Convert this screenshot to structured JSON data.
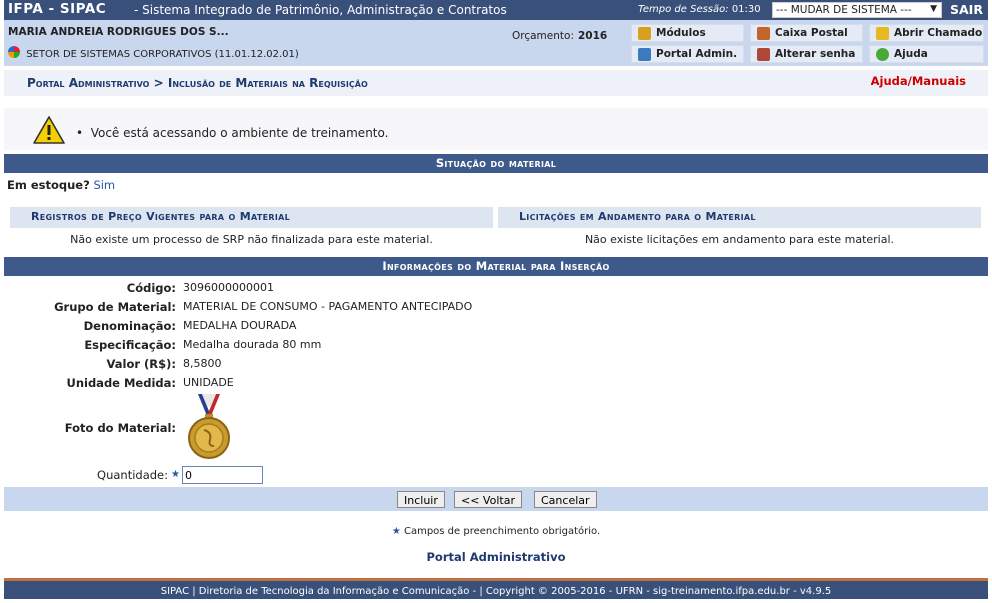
{
  "topbar": {
    "brand": "IFPA - SIPAC",
    "system_name": "- Sistema Integrado de Patrimônio, Administração e Contratos",
    "session_label": "Tempo de Sessão:",
    "session_time": "01:30",
    "system_select": "--- MUDAR DE SISTEMA ---",
    "logout": "SAIR"
  },
  "infobar": {
    "user": "MARIA ANDREIA RODRIGUES DOS S...",
    "department": "SETOR DE SISTEMAS CORPORATIVOS (11.01.12.02.01)",
    "budget_label": "Orçamento:",
    "budget_year": "2016",
    "buttons": {
      "modules": "Módulos",
      "mailbox": "Caixa Postal",
      "ticket": "Abrir Chamado",
      "admin_portal": "Portal Admin.",
      "change_password": "Alterar senha",
      "help": "Ajuda"
    }
  },
  "breadcrumb": {
    "path": "Portal Administrativo > Inclusão de Materiais na Requisição",
    "help_link": "Ajuda/Manuais"
  },
  "warning": {
    "message": "Você está acessando o ambiente de treinamento."
  },
  "material_status": {
    "header": "Situação do material",
    "in_stock_label": "Em estoque?",
    "in_stock_value": "Sim",
    "srp_header": "Registros de Preço Vigentes para o Material",
    "bids_header": "Licitações em Andamento para o Material",
    "srp_message": "Não existe um processo de SRP não finalizada para este material.",
    "bids_message": "Não existe licitações em andamento para este material."
  },
  "material_info": {
    "header": "Informações do Material para Inserção",
    "fields": [
      {
        "label": "Código:",
        "value": "3096000000001"
      },
      {
        "label": "Grupo de Material:",
        "value": "MATERIAL DE CONSUMO - PAGAMENTO ANTECIPADO"
      },
      {
        "label": "Denominação:",
        "value": "MEDALHA DOURADA"
      },
      {
        "label": "Especificação:",
        "value": "Medalha dourada 80 mm"
      },
      {
        "label": "Valor (R$):",
        "value": "8,5800"
      },
      {
        "label": "Unidade Medida:",
        "value": "UNIDADE"
      }
    ],
    "photo_label": "Foto do Material:",
    "quantity_label": "Quantidade:",
    "quantity_value": "0"
  },
  "actions": {
    "include": "Incluir",
    "back": "<< Voltar",
    "cancel": "Cancelar"
  },
  "required_note": "Campos de preenchimento obrigatório.",
  "portal_link": "Portal Administrativo",
  "footer": "SIPAC | Diretoria de Tecnologia da Informação e Comunicação - | Copyright © 2005-2016 - UFRN - sig-treinamento.ifpa.edu.br - v4.9.5",
  "colors": {
    "header_blue": "#39507a",
    "section_blue": "#3e5a8a",
    "info_bg": "#c8d6ee",
    "link_red": "#cc0000"
  }
}
